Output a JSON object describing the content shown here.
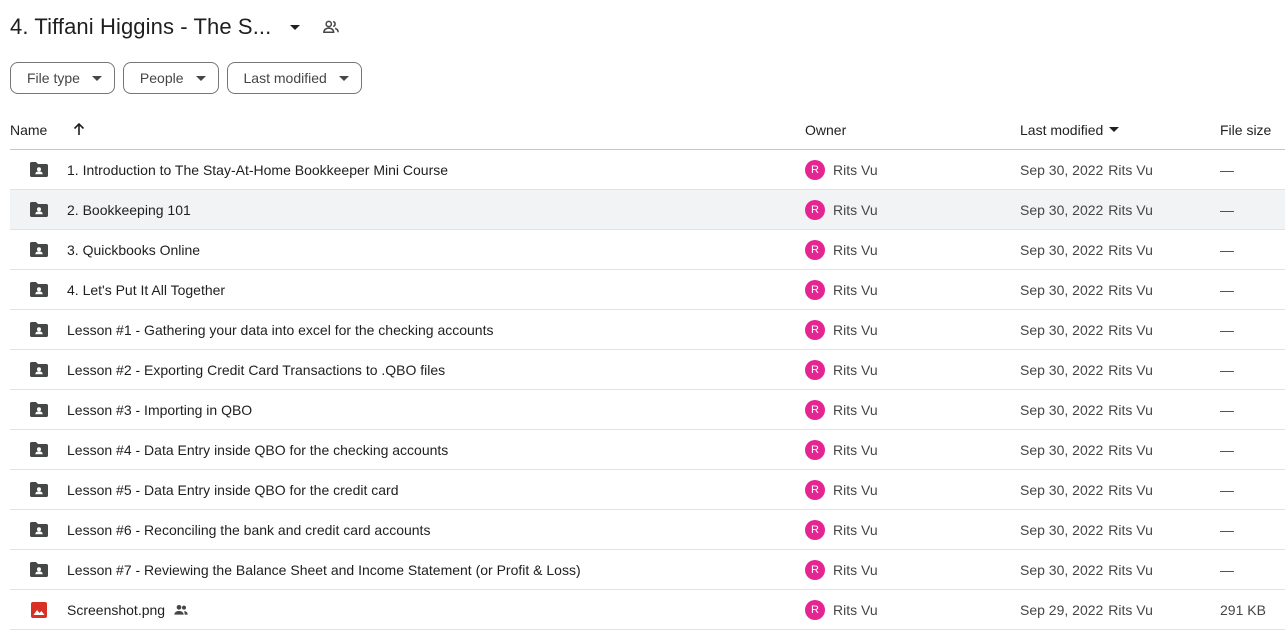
{
  "header": {
    "title": "4. Tiffani Higgins - The S...",
    "icons": {
      "caret": "caret-down-icon",
      "shared": "people-icon"
    }
  },
  "filters": [
    {
      "label": "File type"
    },
    {
      "label": "People"
    },
    {
      "label": "Last modified"
    }
  ],
  "columns": {
    "name": "Name",
    "owner": "Owner",
    "last_modified": "Last modified",
    "file_size": "File size"
  },
  "colors": {
    "avatar": "#e52592",
    "folder": "#444746",
    "image": "#d93025",
    "selected_row": "#f1f3f4"
  },
  "rows": [
    {
      "type": "folder",
      "name": "1. Introduction to The Stay-At-Home Bookkeeper Mini Course",
      "owner_initial": "R",
      "owner": "Rits Vu",
      "date": "Sep 30, 2022",
      "modified_by": "Rits Vu",
      "size": "—"
    },
    {
      "type": "folder",
      "name": "2. Bookkeeping 101",
      "owner_initial": "R",
      "owner": "Rits Vu",
      "date": "Sep 30, 2022",
      "modified_by": "Rits Vu",
      "size": "—",
      "selected": true
    },
    {
      "type": "folder",
      "name": "3. Quickbooks Online",
      "owner_initial": "R",
      "owner": "Rits Vu",
      "date": "Sep 30, 2022",
      "modified_by": "Rits Vu",
      "size": "—"
    },
    {
      "type": "folder",
      "name": "4. Let's Put It All Together",
      "owner_initial": "R",
      "owner": "Rits Vu",
      "date": "Sep 30, 2022",
      "modified_by": "Rits Vu",
      "size": "—"
    },
    {
      "type": "folder",
      "name": "Lesson #1 - Gathering your data into excel for the checking accounts",
      "owner_initial": "R",
      "owner": "Rits Vu",
      "date": "Sep 30, 2022",
      "modified_by": "Rits Vu",
      "size": "—"
    },
    {
      "type": "folder",
      "name": "Lesson #2 - Exporting Credit Card Transactions to .QBO files",
      "owner_initial": "R",
      "owner": "Rits Vu",
      "date": "Sep 30, 2022",
      "modified_by": "Rits Vu",
      "size": "—"
    },
    {
      "type": "folder",
      "name": "Lesson #3 - Importing in QBO",
      "owner_initial": "R",
      "owner": "Rits Vu",
      "date": "Sep 30, 2022",
      "modified_by": "Rits Vu",
      "size": "—"
    },
    {
      "type": "folder",
      "name": "Lesson #4 - Data Entry inside QBO for the checking accounts",
      "owner_initial": "R",
      "owner": "Rits Vu",
      "date": "Sep 30, 2022",
      "modified_by": "Rits Vu",
      "size": "—"
    },
    {
      "type": "folder",
      "name": "Lesson #5 - Data Entry inside QBO for the credit card",
      "owner_initial": "R",
      "owner": "Rits Vu",
      "date": "Sep 30, 2022",
      "modified_by": "Rits Vu",
      "size": "—"
    },
    {
      "type": "folder",
      "name": "Lesson #6 - Reconciling the bank and credit card accounts",
      "owner_initial": "R",
      "owner": "Rits Vu",
      "date": "Sep 30, 2022",
      "modified_by": "Rits Vu",
      "size": "—"
    },
    {
      "type": "folder",
      "name": "Lesson #7 - Reviewing the Balance Sheet and Income Statement (or Profit & Loss)",
      "owner_initial": "R",
      "owner": "Rits Vu",
      "date": "Sep 30, 2022",
      "modified_by": "Rits Vu",
      "size": "—"
    },
    {
      "type": "image",
      "name": "Screenshot.png",
      "shared": true,
      "owner_initial": "R",
      "owner": "Rits Vu",
      "date": "Sep 29, 2022",
      "modified_by": "Rits Vu",
      "size": "291 KB"
    }
  ]
}
